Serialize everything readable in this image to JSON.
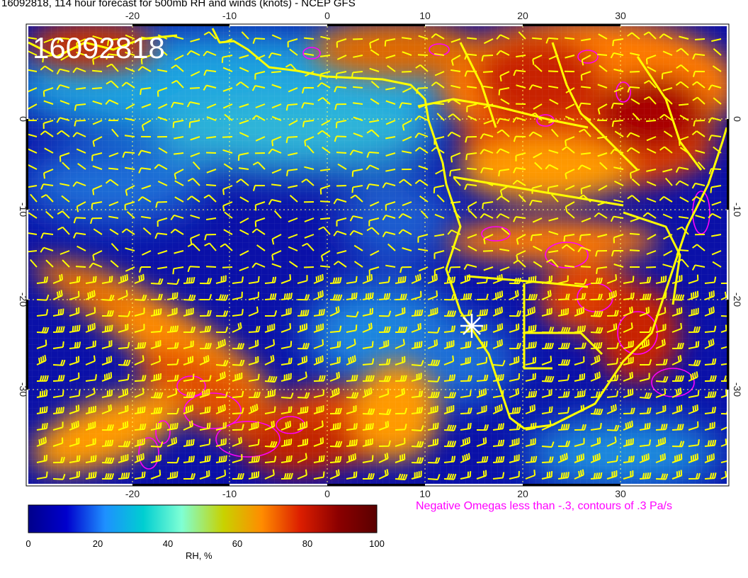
{
  "title": "16092818, 114 hour forecast for 500mb RH and winds (knots) - NCEP GFS",
  "datestamp": "16092818",
  "lon_ticks": [
    "-20",
    "-10",
    "0",
    "10",
    "20",
    "30"
  ],
  "lat_ticks": [
    "0",
    "-10",
    "-20",
    "-30"
  ],
  "colorbar": {
    "label": "RH, %",
    "ticks": [
      "0",
      "20",
      "40",
      "60",
      "80",
      "100"
    ],
    "colors": [
      "#00008b",
      "#0000cd",
      "#1e90ff",
      "#00ced1",
      "#7fffd4",
      "#c8d200",
      "#ff8c00",
      "#dc1e00",
      "#8b0000",
      "#5a0000"
    ]
  },
  "omega_note": "Negative Omegas less than -.3, contours of .3 Pa/s",
  "colors": {
    "coastline": "#ffff00",
    "wind_barbs": "#ffff00",
    "omega_contours": "#ff00ff",
    "grid": "#ffff66"
  }
}
